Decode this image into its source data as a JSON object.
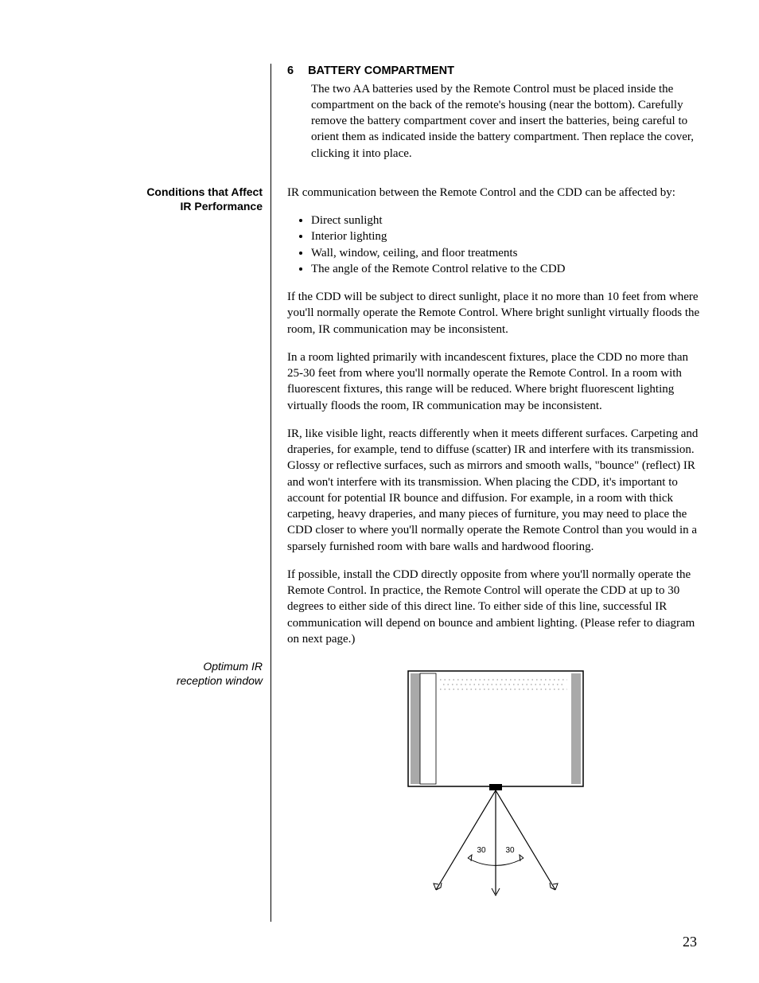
{
  "section6": {
    "number": "6",
    "title": "BATTERY COMPARTMENT",
    "body": "The two AA batteries used by the Remote Control must be placed inside the compartment on the back of the remote's housing (near the bottom). Carefully remove the battery compartment cover and insert the batteries, being careful to orient them as indicated inside the battery compartment. Then replace the cover, clicking it into place."
  },
  "conditions": {
    "side_line1": "Conditions that Affect",
    "side_line2": "IR Performance",
    "intro": "IR communication between the Remote Control and the CDD can be affected by:",
    "bullets": [
      "Direct sunlight",
      "Interior lighting",
      "Wall, window, ceiling, and floor treatments",
      "The angle of the Remote Control relative to the CDD"
    ],
    "p1": "If the CDD will be subject to direct sunlight, place it no more than 10 feet from where you'll normally operate the Remote Control. Where bright sunlight virtually floods the room, IR communication may be inconsistent.",
    "p2": "In a room lighted primarily with incandescent fixtures, place the CDD no more than 25-30 feet from where you'll normally operate the Remote Control. In a room with fluorescent fixtures, this range will be reduced. Where bright fluorescent lighting virtually floods the room, IR communication may be inconsistent.",
    "p3": "IR, like visible light, reacts differently when it meets different surfaces. Carpeting and draperies, for example, tend to diffuse (scatter) IR and interfere with its transmission. Glossy or reflective surfaces, such as mirrors and smooth walls, \"bounce\" (reflect) IR and won't interfere with its transmission. When placing the CDD, it's important to account for potential IR bounce and diffusion. For example, in a room with thick carpeting, heavy draperies, and many pieces of furniture, you may need to place the CDD closer to where you'll normally operate the Remote Control than you would in a sparsely furnished room with bare walls and hardwood flooring.",
    "p4": "If possible, install the CDD directly opposite from where you'll normally operate the Remote Control. In practice, the Remote Control will operate the CDD at up to 30 degrees to either side of this direct line. To either side of this line, successful IR communication will depend on bounce and ambient lighting. (Please refer to diagram on next page.)"
  },
  "diagram": {
    "side_line1": "Optimum IR",
    "side_line2": "reception window",
    "left_angle": "30",
    "right_angle": "30"
  },
  "page_number": "23"
}
